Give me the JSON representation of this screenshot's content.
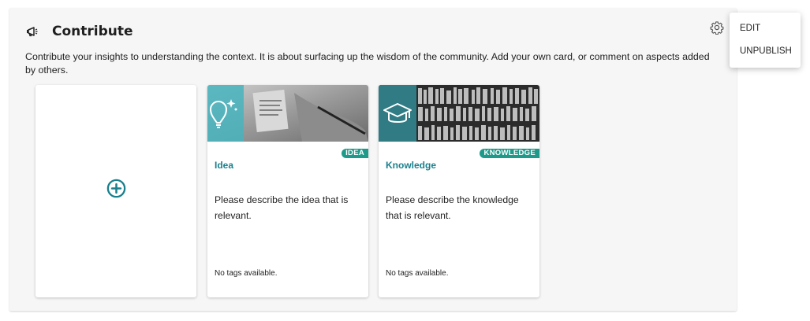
{
  "widget": {
    "title": "Contribute",
    "title_icon": "megaphone-icon",
    "settings_icon": "gear-icon",
    "description": "Contribute your insights to understanding the context. It is about surfacing up the wisdom of the community. Add your own card, or comment on aspects added by others."
  },
  "add_card": {
    "icon": "plus-circle-icon",
    "icon_color": "#1a7f8c"
  },
  "cards": [
    {
      "badge": "IDEA",
      "title": "Idea",
      "text": "Please describe the idea that is relevant.",
      "tags": "No tags available.",
      "overlay_icon": "lightbulb-icon"
    },
    {
      "badge": "KNOWLEDGE",
      "title": "Knowledge",
      "text": "Please describe the knowledge that is relevant.",
      "tags": "No tags available.",
      "overlay_icon": "graduation-cap-icon"
    }
  ],
  "menu": {
    "edit_label": "EDIT",
    "unpublish_label": "UNPUBLISH"
  },
  "colors": {
    "accent_teal": "#1a7f8c",
    "badge_green": "#1e9a8b"
  }
}
